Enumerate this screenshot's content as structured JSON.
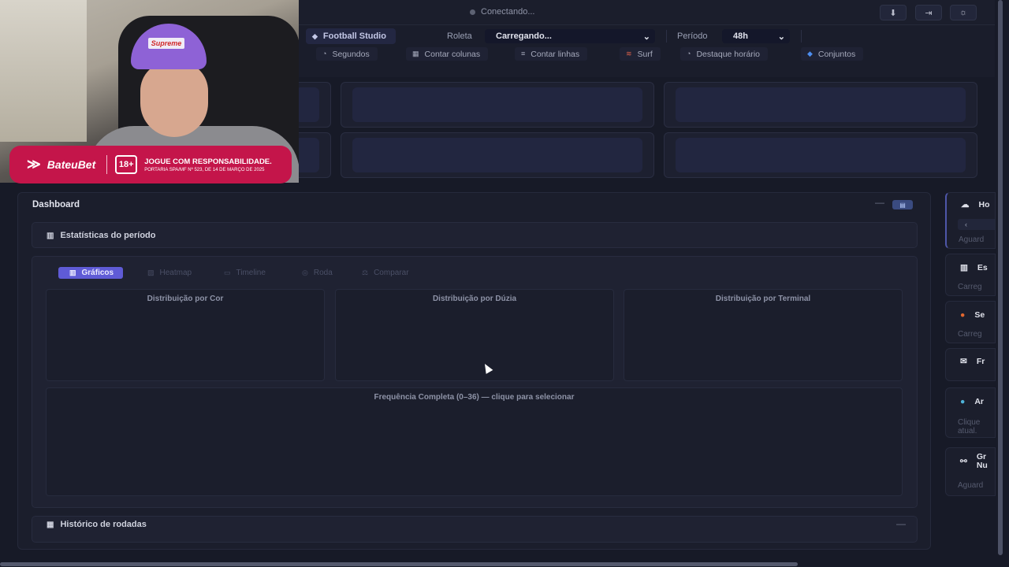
{
  "topbar": {
    "status": "Conectando...",
    "buttons": [
      {
        "icon": "download-icon",
        "glyph": "⬇"
      },
      {
        "icon": "logout-icon",
        "glyph": "⇥"
      },
      {
        "icon": "sun-icon",
        "glyph": "☼"
      }
    ]
  },
  "controls": {
    "game_chip": "Football Studio",
    "roleta_label": "Roleta",
    "roleta_value": "Carregando...",
    "periodo_label": "Período",
    "periodo_value": "48h",
    "toggles": [
      "Segundos",
      "Contar colunas",
      "Contar linhas",
      "Surf",
      "Destaque horário",
      "Conjuntos"
    ]
  },
  "webcam": {
    "cap_text": "Supreme",
    "brand": "BateuBet",
    "age": "18+",
    "warning": "JOGUE COM RESPONSABILIDADE.",
    "legal": "PORTARIA SPA/MF Nº 523, DE 14 DE MARÇO DE 2025"
  },
  "dashboard": {
    "title": "Dashboard",
    "stats_title": "Estatísticas do período",
    "tabs": [
      "Gráficos",
      "Heatmap",
      "Timeline",
      "Roda",
      "Comparar"
    ],
    "panels": [
      "Distribuição por Cor",
      "Distribuição por Dúzia",
      "Distribuição por Terminal"
    ],
    "frequency_title": "Frequência Completa (0–36) — clique para selecionar",
    "history_title": "Histórico de rodadas"
  },
  "sidebar": {
    "cards": [
      {
        "title": "Ho",
        "sub": "Aguard",
        "icon": "cloud-icon"
      },
      {
        "title": "Es",
        "sub": "Carreg",
        "icon": "chart-icon"
      },
      {
        "title": "Se",
        "sub": "Carreg",
        "icon": "fire-icon"
      },
      {
        "title": "Fr",
        "sub": "",
        "icon": "mail-icon"
      },
      {
        "title": "Ar",
        "sub": "Clique\natual.",
        "icon": "magnifier-icon"
      },
      {
        "title": "Gr\nNu",
        "sub": "Aguard",
        "icon": "link-icon"
      }
    ],
    "pill": "‹"
  },
  "colors": {
    "accent": "#5f5bd6",
    "banner": "#c4154a",
    "background": "#171a27"
  }
}
